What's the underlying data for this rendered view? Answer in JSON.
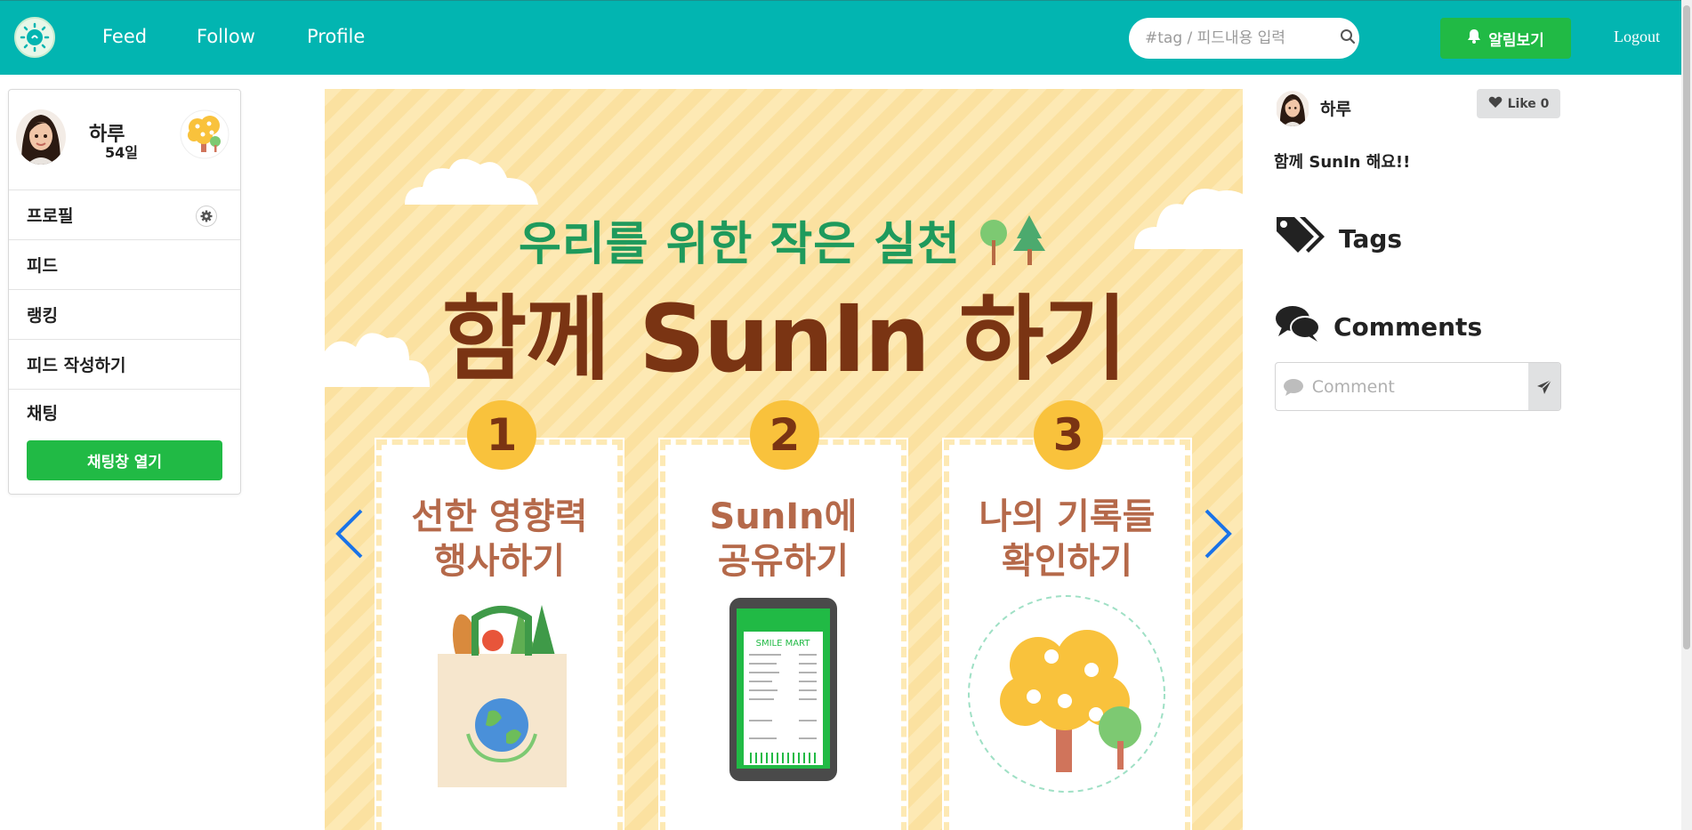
{
  "nav": {
    "links": [
      "Feed",
      "Follow",
      "Profile"
    ],
    "search_placeholder": "#tag / 피드내용 입력",
    "alarm_label": "알림보기",
    "logout_label": "Logout",
    "accent": "#02b5b1"
  },
  "sidebar": {
    "user_name": "하루",
    "days": "54일",
    "items": [
      "프로필",
      "피드",
      "랭킹",
      "피드 작성하기",
      "채팅"
    ],
    "chat_button": "채팅창 열기",
    "button_color": "#21ba45"
  },
  "post_image": {
    "subtitle": "우리를 위한 작은 실천",
    "title": "함께 SunIn 하기",
    "cards": [
      {
        "num": "1",
        "title": "선한 영향력\n행사하기"
      },
      {
        "num": "2",
        "title": "SunIn에\n공유하기"
      },
      {
        "num": "3",
        "title": "나의 기록들\n확인하기"
      }
    ],
    "receipt_header": "SMILE MART"
  },
  "post": {
    "author": "하루",
    "like_label": "Like 0",
    "content": "함께 SunIn 해요!!",
    "tags_heading": "Tags",
    "comments_heading": "Comments",
    "comment_placeholder": "Comment"
  }
}
